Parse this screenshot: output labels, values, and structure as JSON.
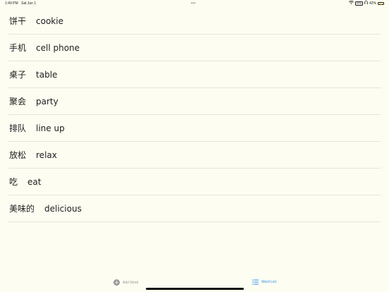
{
  "status_bar": {
    "time": "1:49 PM",
    "date": "Sat Jun 1",
    "dots": "•••",
    "vpn": "VPN",
    "battery_percent": "42%",
    "battery_level": 0.42
  },
  "words": [
    {
      "chinese": "饼干",
      "english": "cookie"
    },
    {
      "chinese": "手机",
      "english": "cell phone"
    },
    {
      "chinese": "桌子",
      "english": "table"
    },
    {
      "chinese": "聚会",
      "english": "party"
    },
    {
      "chinese": "排队",
      "english": "line up"
    },
    {
      "chinese": "放松",
      "english": "relax"
    },
    {
      "chinese": "吃",
      "english": "eat"
    },
    {
      "chinese": "美味的",
      "english": "delicious"
    }
  ],
  "tab_bar": {
    "add_word_label": "Add Word",
    "word_list_label": "Word List",
    "active_color": "#2f8df2",
    "inactive_color": "#9a9a9a"
  }
}
